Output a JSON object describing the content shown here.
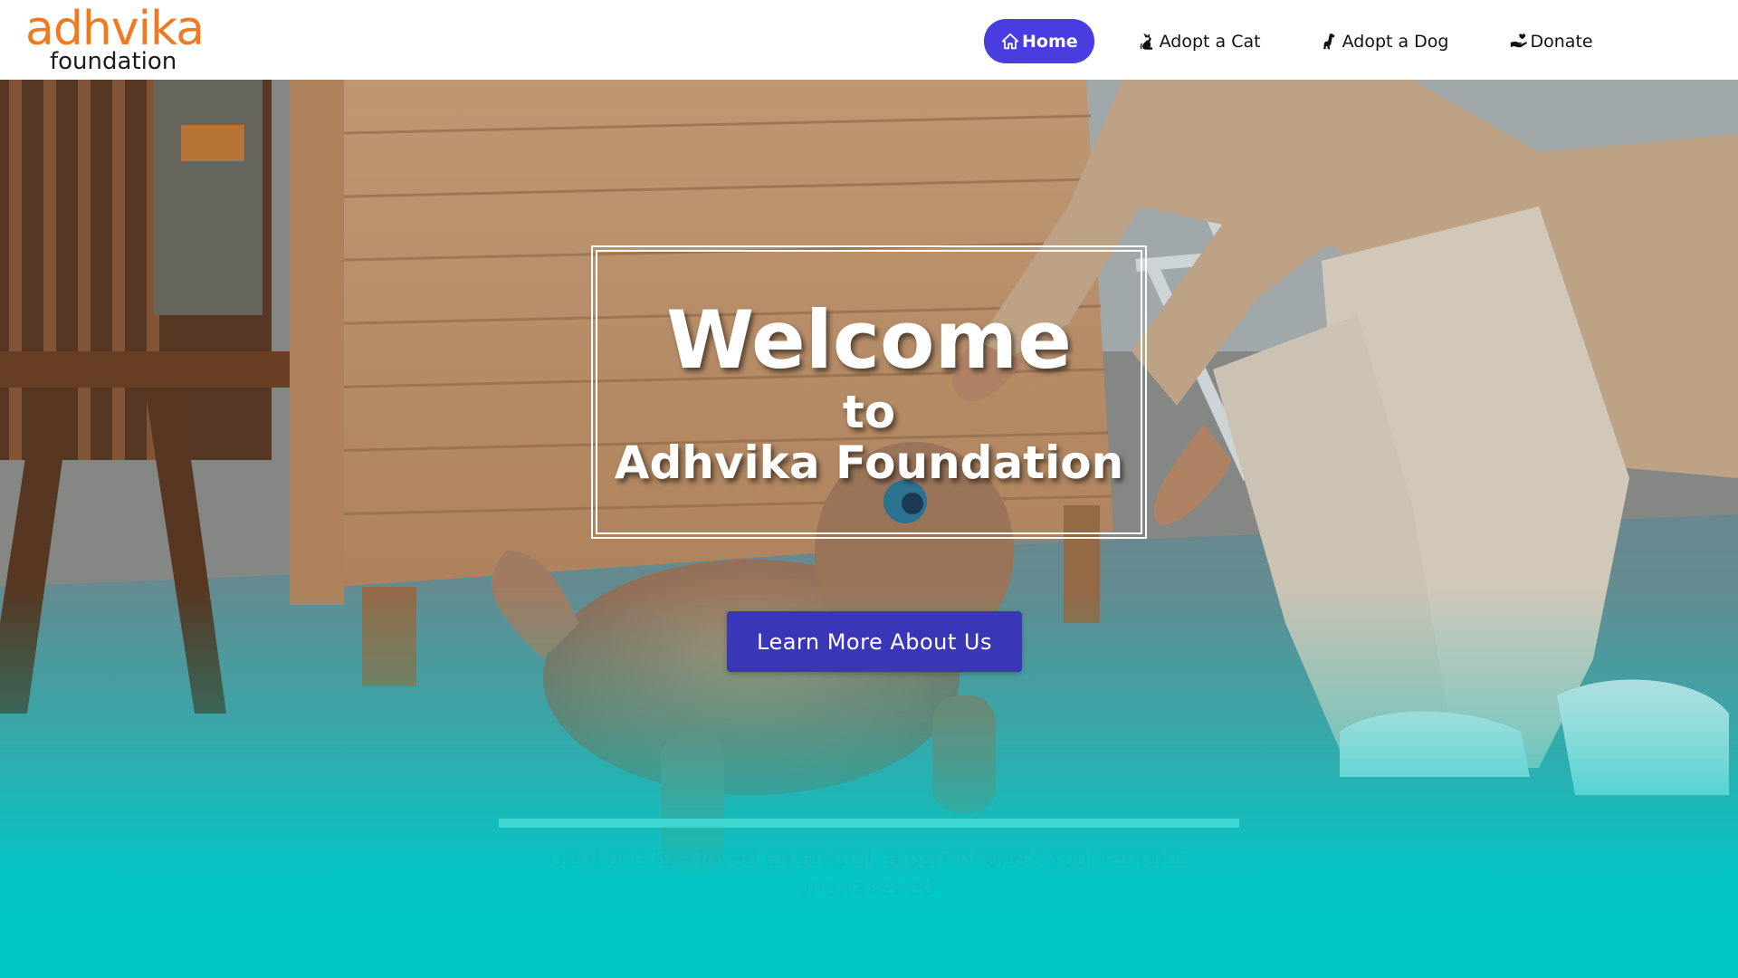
{
  "brand": {
    "logo_top": "adhvika",
    "logo_bottom": "foundation",
    "accent_color": "#f07a22"
  },
  "nav": {
    "items": [
      {
        "label": "Home",
        "icon": "home-icon",
        "active": true
      },
      {
        "label": "Adopt a Cat",
        "icon": "cat-icon",
        "active": false
      },
      {
        "label": "Adopt a Dog",
        "icon": "dog-icon",
        "active": false
      },
      {
        "label": "Donate",
        "icon": "donate-hand-icon",
        "active": false
      }
    ],
    "active_color": "#4a3de0"
  },
  "hero": {
    "title": "Welcome",
    "subtitle_to": "to",
    "subtitle_org": "Adhvika Foundation",
    "cta_label": "Learn More About Us",
    "cta_color": "#3a36b8",
    "quote": "Until one has loved an animal, a part of one's soul remains unawakened.",
    "gradient_color": "#00c8c8"
  }
}
